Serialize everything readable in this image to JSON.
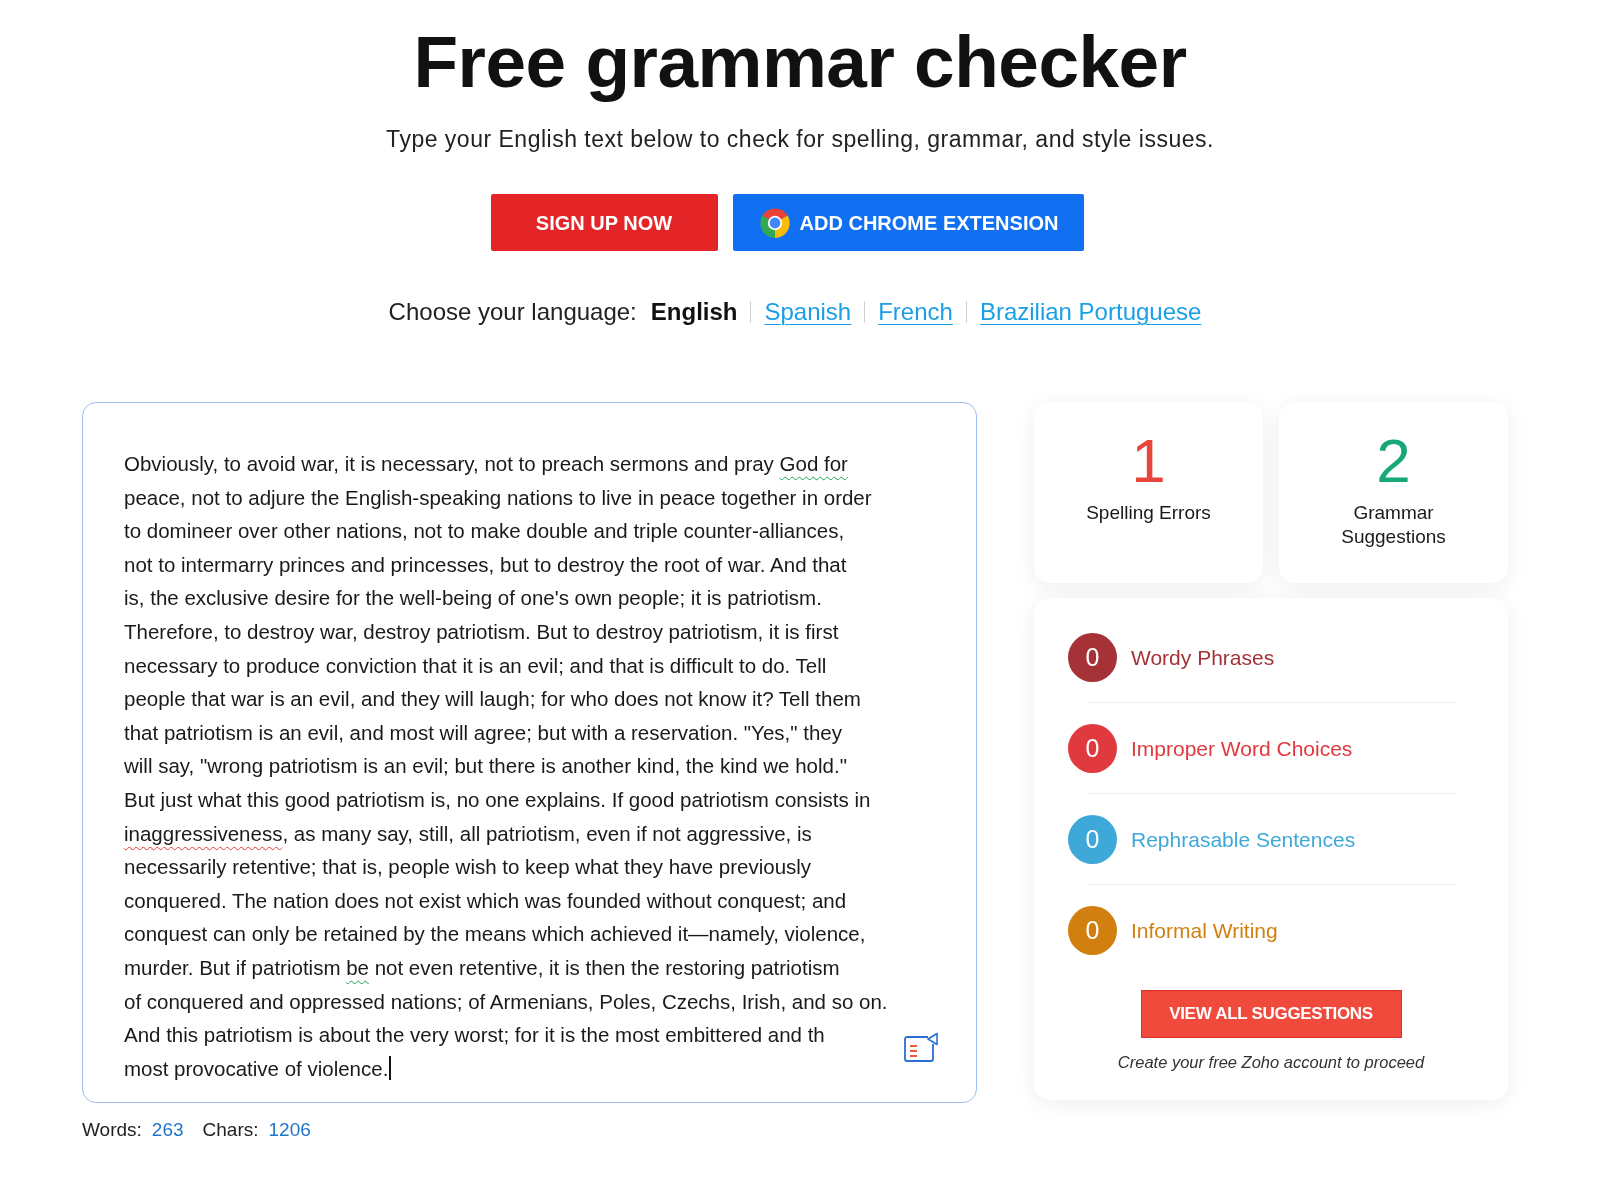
{
  "header": {
    "title": "Free grammar checker",
    "subtitle": "Type your English text below to check for spelling, grammar, and style issues."
  },
  "actions": [
    {
      "label": "SIGN UP NOW",
      "kind": "signup"
    },
    {
      "label": "ADD CHROME EXTENSION",
      "kind": "extension"
    }
  ],
  "language": {
    "label": "Choose your language:",
    "options": [
      {
        "label": "English",
        "selected": true
      },
      {
        "label": "Spanish",
        "selected": false
      },
      {
        "label": "French",
        "selected": false
      },
      {
        "label": "Brazilian Portuguese",
        "selected": false
      }
    ]
  },
  "editor": {
    "focused": true,
    "lines": [
      [
        {
          "text": "Obviously, to avoid war, it is necessary, not to preach sermons and pray ",
          "kind": "plain"
        },
        {
          "text": "God for",
          "kind": "grammar"
        }
      ],
      [
        {
          "text": "peace, not to adjure the English-speaking nations to live in peace together in order",
          "kind": "plain"
        }
      ],
      [
        {
          "text": "to domineer over other nations, not to make double and triple counter-alliances,",
          "kind": "plain"
        }
      ],
      [
        {
          "text": "not to intermarry princes and princesses, but to destroy the root of war. And that",
          "kind": "plain"
        }
      ],
      [
        {
          "text": "is, the exclusive desire for the well-being of one's own people; it is patriotism.",
          "kind": "plain"
        }
      ],
      [
        {
          "text": "Therefore, to destroy war, destroy patriotism. But to destroy patriotism, it is first",
          "kind": "plain"
        }
      ],
      [
        {
          "text": "necessary to produce conviction that it is an evil; and that is difficult to do. Tell",
          "kind": "plain"
        }
      ],
      [
        {
          "text": "people that war is an evil, and they will laugh; for who does not know it? Tell them",
          "kind": "plain"
        }
      ],
      [
        {
          "text": "that patriotism is an evil, and most will agree; but with a reservation. \"Yes,\" they",
          "kind": "plain"
        }
      ],
      [
        {
          "text": "will say, \"wrong patriotism is an evil; but there is another kind, the kind we hold.\"",
          "kind": "plain"
        }
      ],
      [
        {
          "text": "But just what this good patriotism is, no one explains. If good patriotism consists in",
          "kind": "plain"
        }
      ],
      [
        {
          "text": "inaggressiveness",
          "kind": "spelling"
        },
        {
          "text": ", as many say, still, all patriotism, even if not aggressive, is",
          "kind": "plain"
        }
      ],
      [
        {
          "text": "necessarily retentive; that is, people wish to keep what they have previously",
          "kind": "plain"
        }
      ],
      [
        {
          "text": "conquered. The nation does not exist which was founded without conquest; and",
          "kind": "plain"
        }
      ],
      [
        {
          "text": "conquest can only be retained by the means which achieved it—namely, violence,",
          "kind": "plain"
        }
      ],
      [
        {
          "text": "murder. But if patriotism ",
          "kind": "plain"
        },
        {
          "text": "be",
          "kind": "grammar"
        },
        {
          "text": " not even retentive, it is then the restoring patriotism",
          "kind": "plain"
        }
      ],
      [
        {
          "text": "of conquered and oppressed nations; of Armenians, Poles, Czechs, Irish, and so on.",
          "kind": "plain"
        }
      ],
      [
        {
          "text": "And this patriotism is about the very worst; for it is the most embittered and th",
          "kind": "plain"
        }
      ],
      [
        {
          "text": "most provocative of violence.",
          "kind": "plain"
        }
      ]
    ]
  },
  "counts": [
    {
      "label": "Words:",
      "value": "263"
    },
    {
      "label": "Chars:",
      "value": "1206"
    }
  ],
  "summary": [
    {
      "count": "1",
      "label": "Spelling Errors",
      "color": "#e8453c"
    },
    {
      "count": "2",
      "label": "Grammar Suggestions",
      "color": "#17a77a"
    }
  ],
  "categories": [
    {
      "count": "0",
      "label": "Wordy Phrases",
      "color": "#a53236"
    },
    {
      "count": "0",
      "label": "Improper Word Choices",
      "color": "#e0393e"
    },
    {
      "count": "0",
      "label": "Rephrasable Sentences",
      "color": "#3ea9d9"
    },
    {
      "count": "0",
      "label": "Informal Writing",
      "color": "#d17f0e"
    }
  ],
  "cta": {
    "label": "VIEW ALL SUGGESTIONS",
    "note": "Create your free Zoho account to proceed"
  }
}
